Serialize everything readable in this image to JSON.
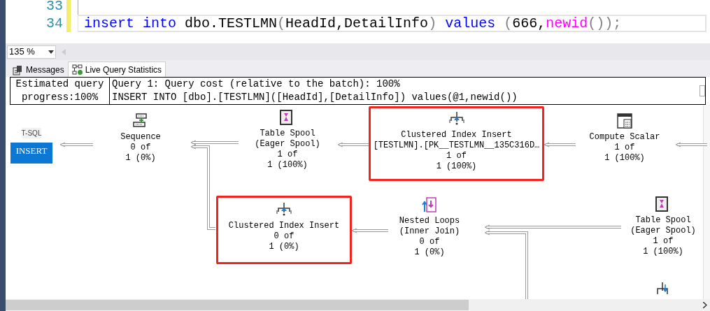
{
  "editor": {
    "lines": [
      {
        "number": "33",
        "changed": true
      },
      {
        "number": "34",
        "changed": true,
        "current": true,
        "tokens": [
          {
            "text": "insert into",
            "kind": "keyword"
          },
          {
            "text": " dbo.TESTLMN",
            "kind": "plain"
          },
          {
            "text": "(",
            "kind": "punct"
          },
          {
            "text": "HeadId,DetailInfo",
            "kind": "plain"
          },
          {
            "text": ")",
            "kind": "punct"
          },
          {
            "text": " values ",
            "kind": "keyword"
          },
          {
            "text": "(",
            "kind": "punct"
          },
          {
            "text": "666,",
            "kind": "plain"
          },
          {
            "text": "newid",
            "kind": "function"
          },
          {
            "text": "());",
            "kind": "punct"
          }
        ]
      }
    ]
  },
  "zoom": {
    "value": "135 %"
  },
  "tabs": [
    {
      "label": "Messages",
      "selected": false
    },
    {
      "label": "Live Query Statistics",
      "selected": true
    }
  ],
  "query_header": {
    "progress": [
      "Estimated query",
      "progress:100%"
    ],
    "lines": [
      "Query 1: Query cost (relative to the batch): 100%",
      "INSERT INTO [dbo].[TESTLMN]([HeadId],[DetailInfo]) values(@1,newid())"
    ]
  },
  "plan": {
    "root": {
      "label": "T-SQL",
      "statement": "INSERT"
    },
    "nodes": [
      {
        "kind": "sequence",
        "lines": [
          "Sequence",
          "0 of",
          "1 (0%)"
        ],
        "highlighted": false
      },
      {
        "kind": "table-spool",
        "lines": [
          "Table Spool",
          "(Eager Spool)",
          "1 of",
          "1 (100%)"
        ],
        "highlighted": false
      },
      {
        "kind": "index-insert",
        "lines": [
          "Clustered Index Insert",
          "[TESTLMN].[PK__TESTLMN__135C316D…",
          "1 of",
          "1 (100%)"
        ],
        "highlighted": true
      },
      {
        "kind": "compute-scalar",
        "lines": [
          "Compute Scalar",
          "1 of",
          "1 (100%)"
        ],
        "highlighted": false
      },
      {
        "kind": "index-insert",
        "lines": [
          "Clustered Index Insert",
          "0 of",
          "1 (0%)"
        ],
        "highlighted": true
      },
      {
        "kind": "nested-loops",
        "lines": [
          "Nested Loops",
          "(Inner Join)",
          "0 of",
          "1 (0%)"
        ],
        "highlighted": false
      },
      {
        "kind": "table-spool",
        "lines": [
          "Table Spool",
          "(Eager Spool)",
          "1 of",
          "1 (100%)"
        ],
        "highlighted": false
      },
      {
        "kind": "index-update",
        "highlighted": false
      }
    ]
  }
}
